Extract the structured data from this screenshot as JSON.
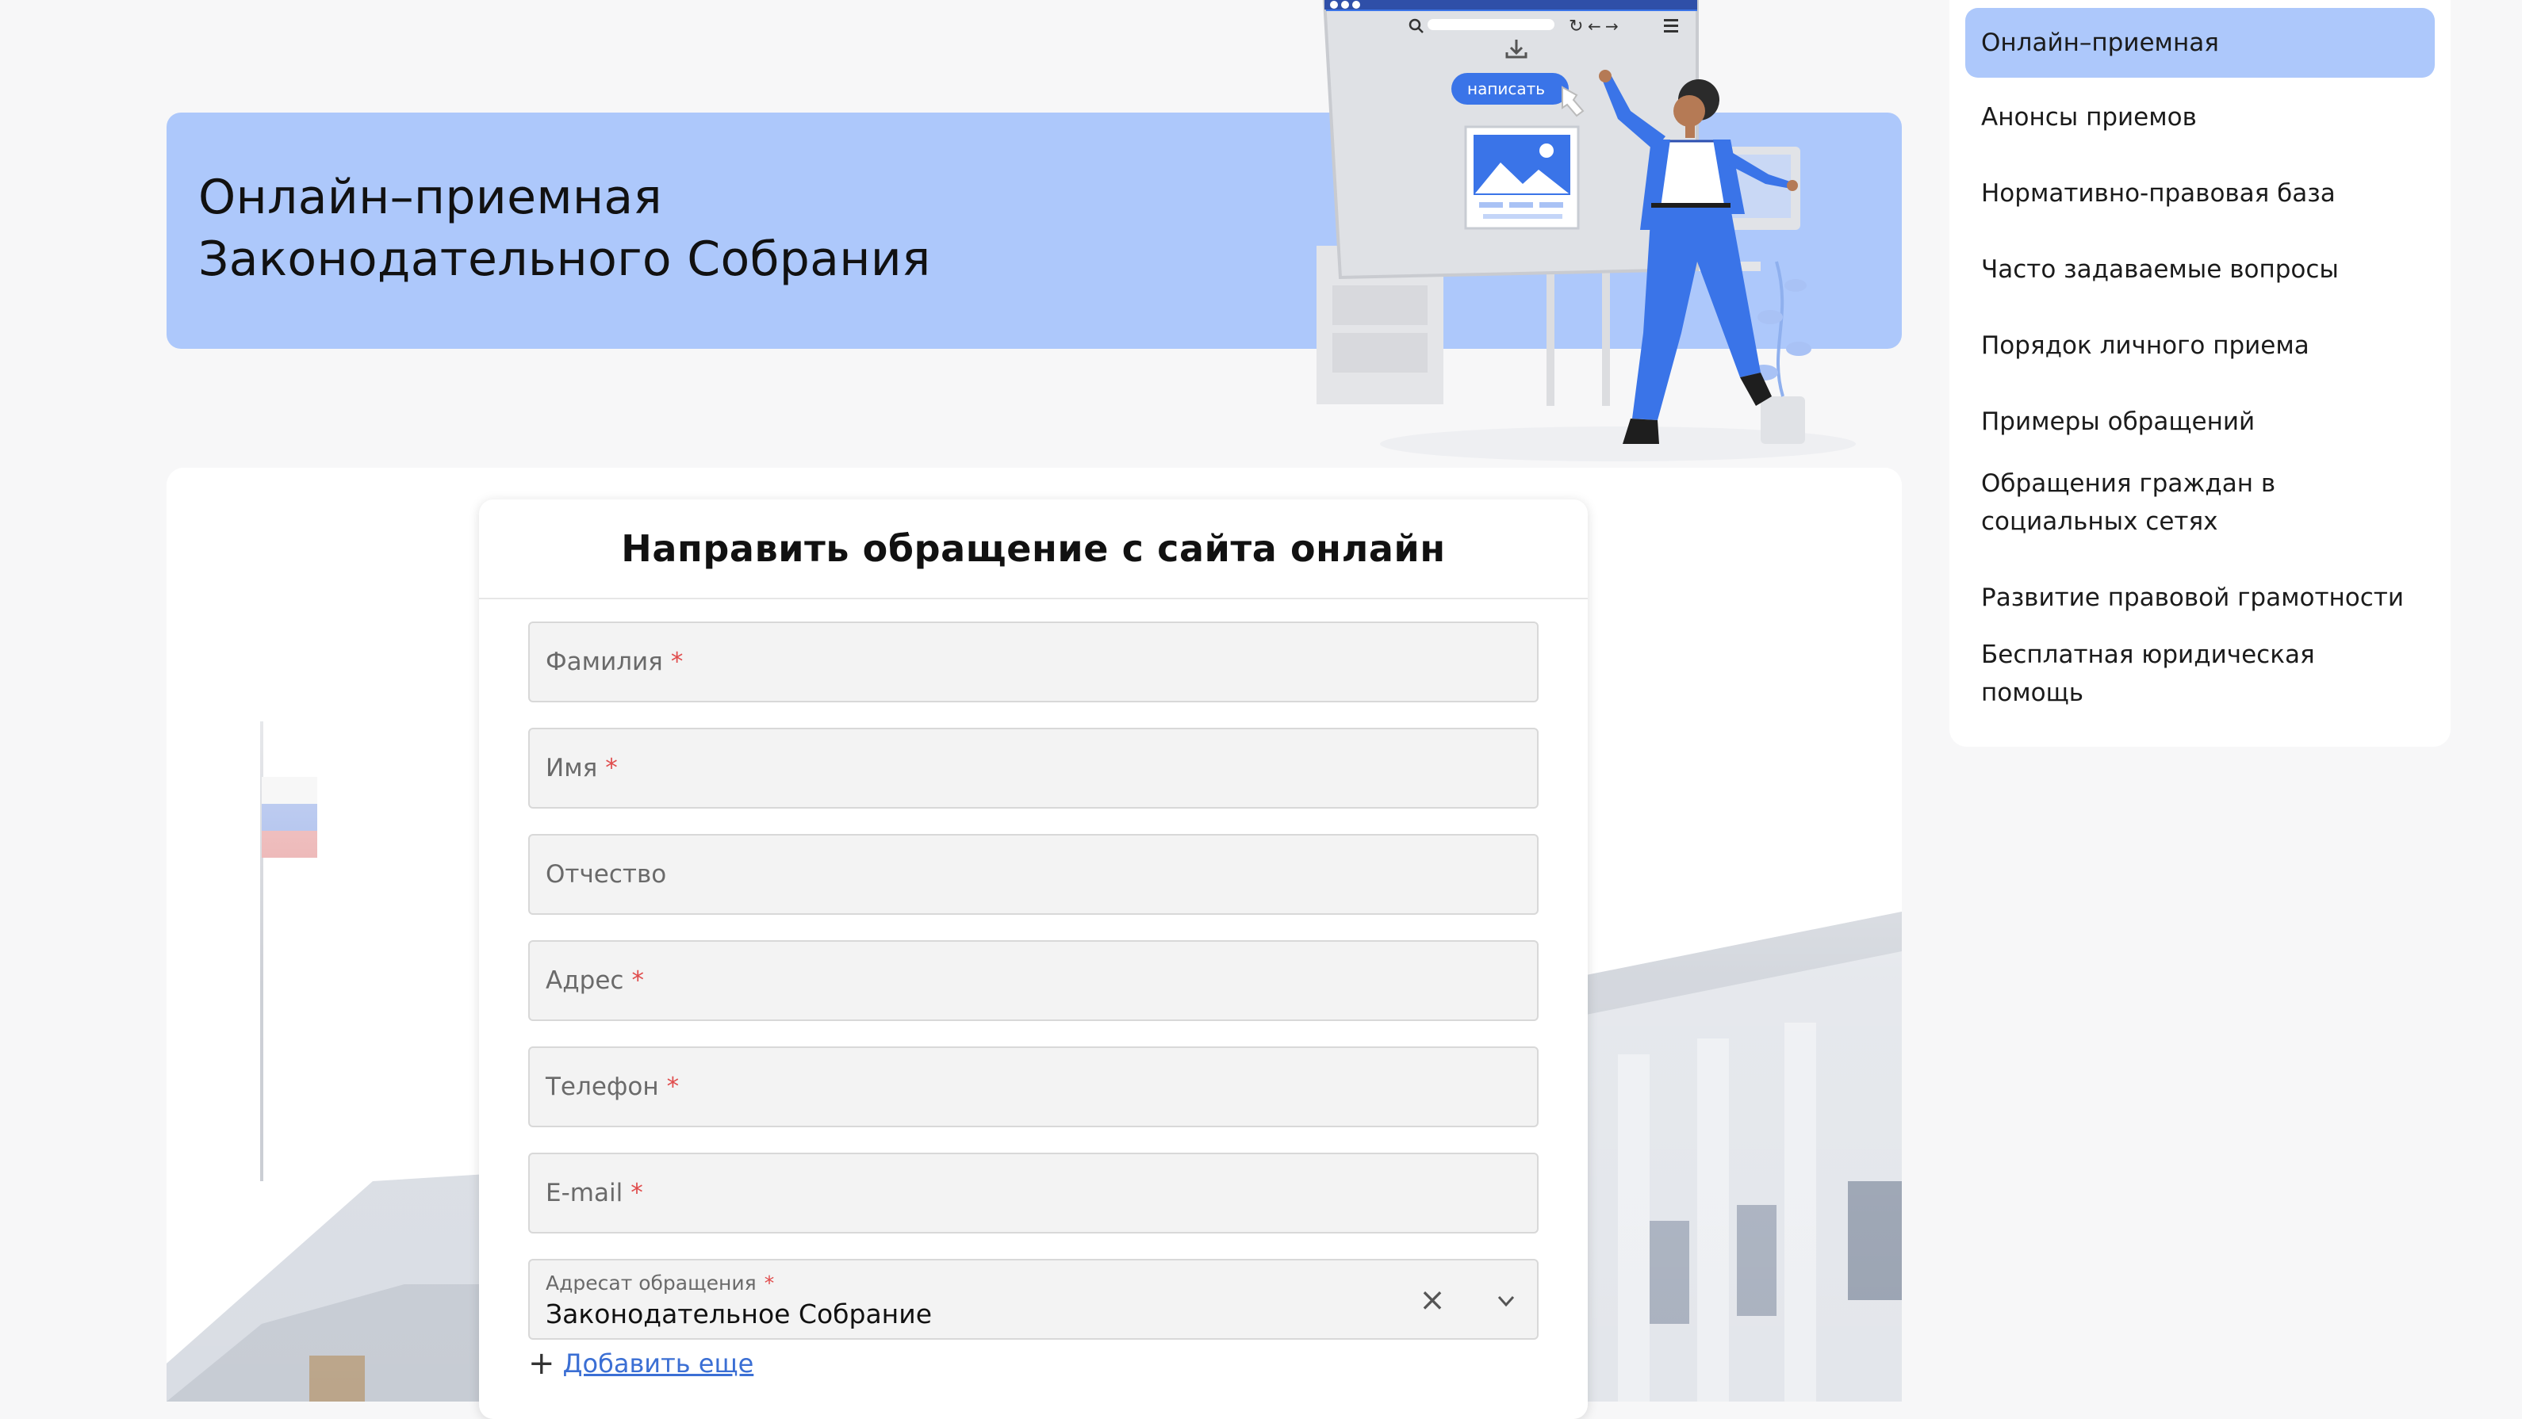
{
  "hero": {
    "title_line1": "Онлайн–приемная",
    "title_line2": "Законодательного Собрания"
  },
  "illustration": {
    "button_label": "написать",
    "icons": [
      "search-icon",
      "refresh-icon",
      "back-arrow-icon",
      "forward-arrow-icon",
      "menu-icon",
      "download-icon",
      "image-icon"
    ]
  },
  "form": {
    "title": "Направить обращение с сайта онлайн",
    "fields": [
      {
        "label": "Фамилия",
        "value": "",
        "required": "*"
      },
      {
        "label": "Имя",
        "value": "",
        "required": "*"
      },
      {
        "label": "Отчество",
        "value": "",
        "required": ""
      },
      {
        "label": "Адрес",
        "value": "",
        "required": "*"
      },
      {
        "label": "Телефон",
        "value": "",
        "required": "*"
      },
      {
        "label": "E-mail",
        "value": "",
        "required": "*"
      }
    ],
    "recipient": {
      "label": "Адресат обращения",
      "required": "*",
      "value": "Законодательное Собрание",
      "clear_glyph": "×"
    },
    "add_more": {
      "plus": "+",
      "label": "Добавить еще"
    }
  },
  "sidebar": {
    "items": [
      {
        "label": "Онлайн–приемная",
        "active": true
      },
      {
        "label": "Анонсы приемов"
      },
      {
        "label": "Нормативно-правовая база"
      },
      {
        "label": "Часто задаваемые вопросы"
      },
      {
        "label": "Порядок личного приема"
      },
      {
        "label": "Примеры обращений"
      },
      {
        "label": "Обращения граждан в социальных сетях"
      },
      {
        "label": "Развитие правовой грамотности"
      },
      {
        "label": "Бесплатная юридическая помощь"
      }
    ]
  },
  "colors": {
    "accent": "#adc8fb",
    "link": "#3b6fd4",
    "required": "#e04c4c",
    "illustration_blue": "#3a74e8"
  }
}
